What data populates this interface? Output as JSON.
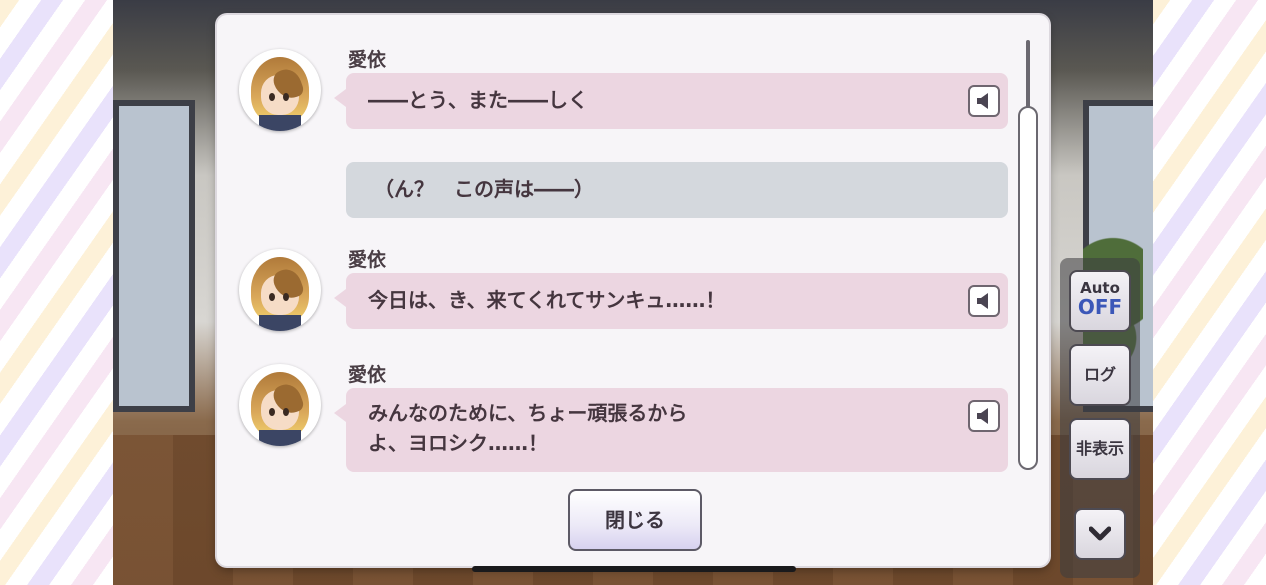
{
  "log": [
    {
      "speaker": "愛依",
      "lines": [
        "――とう、また――しく"
      ],
      "has_voice": true
    },
    {
      "speaker": "",
      "lines": [
        "（ん？　この声は――）"
      ],
      "has_voice": false
    },
    {
      "speaker": "愛依",
      "lines": [
        "今日は、き、来てくれてサンキュ……！"
      ],
      "has_voice": true
    },
    {
      "speaker": "愛依",
      "lines": [
        "みんなのために、ちょー頑張るから",
        "よ、ヨロシク……！"
      ],
      "has_voice": true
    }
  ],
  "close_label": "閉じる",
  "controls": {
    "auto_top": "Auto",
    "auto_state": "OFF",
    "log_label": "ログ",
    "hide_label": "非表示"
  },
  "colors": {
    "bubble_character": "#ecd6e1",
    "bubble_narration": "#d4d8dd",
    "auto_state": "#3b57b8"
  },
  "icons": {
    "voice": "speaker-icon",
    "chevron": "chevron-down-icon"
  }
}
